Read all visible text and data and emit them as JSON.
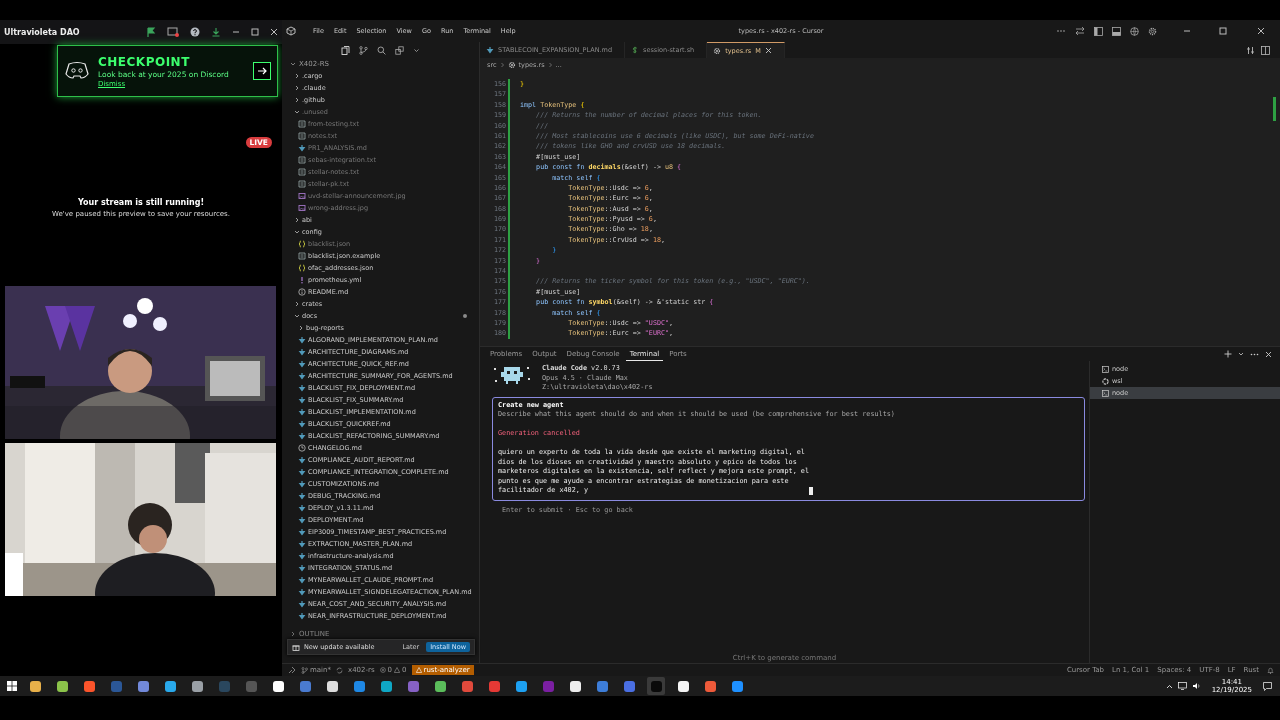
{
  "discord": {
    "title": "Ultravioleta DAO",
    "banner": {
      "heading": "CHECKPOINT",
      "text": "Look back at your 2025 on Discord",
      "link": "Dismiss"
    },
    "live_badge": "LIVE",
    "stream_notice": {
      "title": "Your stream is still running!",
      "text": "We've paused this preview to save your resources."
    }
  },
  "editor_window": {
    "menu": [
      "File",
      "Edit",
      "Selection",
      "View",
      "Go",
      "Run",
      "Terminal",
      "Help"
    ],
    "title": "types.rs - x402-rs - Cursor",
    "explorer": {
      "root": "X402-RS",
      "outline": "OUTLINE",
      "tree": [
        {
          "label": ".cargo",
          "kind": "folder",
          "expanded": false,
          "dimmed": false,
          "modified": false
        },
        {
          "label": ".claude",
          "kind": "folder",
          "expanded": false,
          "dimmed": false,
          "modified": false
        },
        {
          "label": ".github",
          "kind": "folder",
          "expanded": false,
          "dimmed": false,
          "modified": false
        },
        {
          "label": ".unused",
          "kind": "folder",
          "expanded": true,
          "dimmed": true,
          "modified": false,
          "children": [
            {
              "label": "from-testing.txt",
              "kind": "txt",
              "dimmed": true,
              "modified": false
            },
            {
              "label": "notes.txt",
              "kind": "txt",
              "dimmed": true,
              "modified": false
            },
            {
              "label": "PR1_ANALYSIS.md",
              "kind": "md",
              "dimmed": true,
              "modified": false
            },
            {
              "label": "sebas-integration.txt",
              "kind": "txt",
              "dimmed": true,
              "modified": false
            },
            {
              "label": "stellar-notes.txt",
              "kind": "txt",
              "dimmed": true,
              "modified": false
            },
            {
              "label": "stellar-pk.txt",
              "kind": "txt",
              "dimmed": true,
              "modified": false
            },
            {
              "label": "uvd-stellar-announcement.jpg",
              "kind": "jpg",
              "dimmed": true,
              "modified": false
            },
            {
              "label": "wrong-address.jpg",
              "kind": "jpg",
              "dimmed": true,
              "modified": false
            }
          ]
        },
        {
          "label": "abi",
          "kind": "folder",
          "expanded": false,
          "dimmed": false,
          "modified": false
        },
        {
          "label": "config",
          "kind": "folder",
          "expanded": true,
          "dimmed": false,
          "modified": false,
          "children": [
            {
              "label": "blacklist.json",
              "kind": "json",
              "dimmed": true,
              "modified": false
            },
            {
              "label": "blacklist.json.example",
              "kind": "txt",
              "dimmed": false,
              "modified": false
            },
            {
              "label": "ofac_addresses.json",
              "kind": "json",
              "dimmed": false,
              "modified": false
            },
            {
              "label": "prometheus.yml",
              "kind": "yml",
              "dimmed": false,
              "modified": false
            },
            {
              "label": "README.md",
              "kind": "info",
              "dimmed": false,
              "modified": false
            }
          ]
        },
        {
          "label": "crates",
          "kind": "folder",
          "expanded": false,
          "dimmed": false,
          "modified": false
        },
        {
          "label": "docs",
          "kind": "folder",
          "expanded": true,
          "dimmed": false,
          "modified": true,
          "children": [
            {
              "label": "bug-reports",
              "kind": "folder",
              "expanded": false,
              "dimmed": false,
              "modified": false
            },
            {
              "label": "ALGORAND_IMPLEMENTATION_PLAN.md",
              "kind": "md",
              "dimmed": false,
              "modified": false
            },
            {
              "label": "ARCHITECTURE_DIAGRAMS.md",
              "kind": "md",
              "dimmed": false,
              "modified": false
            },
            {
              "label": "ARCHITECTURE_QUICK_REF.md",
              "kind": "md",
              "dimmed": false,
              "modified": false
            },
            {
              "label": "ARCHITECTURE_SUMMARY_FOR_AGENTS.md",
              "kind": "md",
              "dimmed": false,
              "modified": false
            },
            {
              "label": "BLACKLIST_FIX_DEPLOYMENT.md",
              "kind": "md",
              "dimmed": false,
              "modified": false
            },
            {
              "label": "BLACKLIST_FIX_SUMMARY.md",
              "kind": "md",
              "dimmed": false,
              "modified": false
            },
            {
              "label": "BLACKLIST_IMPLEMENTATION.md",
              "kind": "md",
              "dimmed": false,
              "modified": false
            },
            {
              "label": "BLACKLIST_QUICKREF.md",
              "kind": "md",
              "dimmed": false,
              "modified": false
            },
            {
              "label": "BLACKLIST_REFACTORING_SUMMARY.md",
              "kind": "md",
              "dimmed": false,
              "modified": false
            },
            {
              "label": "CHANGELOG.md",
              "kind": "changelog",
              "dimmed": false,
              "modified": false
            },
            {
              "label": "COMPLIANCE_AUDIT_REPORT.md",
              "kind": "md",
              "dimmed": false,
              "modified": false
            },
            {
              "label": "COMPLIANCE_INTEGRATION_COMPLETE.md",
              "kind": "md",
              "dimmed": false,
              "modified": false
            },
            {
              "label": "CUSTOMIZATIONS.md",
              "kind": "md",
              "dimmed": false,
              "modified": false
            },
            {
              "label": "DEBUG_TRACKING.md",
              "kind": "md",
              "dimmed": false,
              "modified": false
            },
            {
              "label": "DEPLOY_v1.3.11.md",
              "kind": "md",
              "dimmed": false,
              "modified": false
            },
            {
              "label": "DEPLOYMENT.md",
              "kind": "md",
              "dimmed": false,
              "modified": false
            },
            {
              "label": "EIP3009_TIMESTAMP_BEST_PRACTICES.md",
              "kind": "md",
              "dimmed": false,
              "modified": false
            },
            {
              "label": "EXTRACTION_MASTER_PLAN.md",
              "kind": "md",
              "dimmed": false,
              "modified": false
            },
            {
              "label": "infrastructure-analysis.md",
              "kind": "md",
              "dimmed": false,
              "modified": false
            },
            {
              "label": "INTEGRATION_STATUS.md",
              "kind": "md",
              "dimmed": false,
              "modified": false
            },
            {
              "label": "MYNEARWALLET_CLAUDE_PROMPT.md",
              "kind": "md",
              "dimmed": false,
              "modified": false
            },
            {
              "label": "MYNEARWALLET_SIGNDELEGATEACTION_PLAN.md",
              "kind": "md",
              "dimmed": false,
              "modified": false
            },
            {
              "label": "NEAR_COST_AND_SECURITY_ANALYSIS.md",
              "kind": "md",
              "dimmed": false,
              "modified": false
            },
            {
              "label": "NEAR_INFRASTRUCTURE_DEPLOYMENT.md",
              "kind": "md",
              "dimmed": false,
              "modified": false
            }
          ]
        }
      ]
    },
    "tabs": [
      {
        "label": "STABLECOIN_EXPANSION_PLAN.md",
        "kind": "md",
        "selected": false
      },
      {
        "label": "session-start.sh",
        "kind": "sh",
        "selected": false
      },
      {
        "label": "types.rs",
        "kind": "rs",
        "selected": true,
        "badge": "M"
      }
    ],
    "breadcrumb": [
      "src",
      "types.rs",
      "..."
    ],
    "code": [
      {
        "number": "156",
        "tokens": [
          {
            "kind": "p0",
            "text": "}"
          }
        ]
      },
      {
        "number": "157"
      },
      {
        "number": "158",
        "tokens": [
          {
            "kind": "k",
            "text": "impl "
          },
          {
            "kind": "t",
            "text": "TokenType "
          },
          {
            "kind": "p0",
            "text": "{"
          }
        ]
      },
      {
        "number": "159",
        "tokens": [
          {
            "kind": "c",
            "text": "    /// Returns the number of decimal places for this token."
          }
        ]
      },
      {
        "number": "160",
        "tokens": [
          {
            "kind": "c",
            "text": "    ///"
          }
        ]
      },
      {
        "number": "161",
        "tokens": [
          {
            "kind": "c",
            "text": "    /// Most stablecoins use 6 decimals (like USDC), but some DeFi-native"
          }
        ]
      },
      {
        "number": "162",
        "tokens": [
          {
            "kind": "c",
            "text": "    /// tokens like GHO and crvUSD use 18 decimals."
          }
        ]
      },
      {
        "number": "163",
        "tokens": [
          {
            "kind": "x",
            "text": "    #[must_use]"
          }
        ]
      },
      {
        "number": "164",
        "tokens": [
          {
            "kind": "k",
            "text": "    pub const fn "
          },
          {
            "kind": "f",
            "text": "decimals"
          },
          {
            "kind": "x",
            "text": "(&self) -> "
          },
          {
            "kind": "t",
            "text": "u8 "
          },
          {
            "kind": "p1",
            "text": "{"
          }
        ]
      },
      {
        "number": "165",
        "tokens": [
          {
            "kind": "k",
            "text": "        match self "
          },
          {
            "kind": "p2",
            "text": "{"
          }
        ]
      },
      {
        "number": "166",
        "tokens": [
          {
            "kind": "t",
            "text": "            TokenType"
          },
          {
            "kind": "x",
            "text": "::Usdc => "
          },
          {
            "kind": "n",
            "text": "6"
          },
          {
            "kind": "x",
            "text": ","
          }
        ]
      },
      {
        "number": "167",
        "tokens": [
          {
            "kind": "t",
            "text": "            TokenType"
          },
          {
            "kind": "x",
            "text": "::Eurc => "
          },
          {
            "kind": "n",
            "text": "6"
          },
          {
            "kind": "x",
            "text": ","
          }
        ]
      },
      {
        "number": "168",
        "tokens": [
          {
            "kind": "t",
            "text": "            TokenType"
          },
          {
            "kind": "x",
            "text": "::Ausd => "
          },
          {
            "kind": "n",
            "text": "6"
          },
          {
            "kind": "x",
            "text": ","
          }
        ]
      },
      {
        "number": "169",
        "tokens": [
          {
            "kind": "t",
            "text": "            TokenType"
          },
          {
            "kind": "x",
            "text": "::Pyusd => "
          },
          {
            "kind": "n",
            "text": "6"
          },
          {
            "kind": "x",
            "text": ","
          }
        ]
      },
      {
        "number": "170",
        "tokens": [
          {
            "kind": "t",
            "text": "            TokenType"
          },
          {
            "kind": "x",
            "text": "::Gho => "
          },
          {
            "kind": "n",
            "text": "18"
          },
          {
            "kind": "x",
            "text": ","
          }
        ]
      },
      {
        "number": "171",
        "tokens": [
          {
            "kind": "t",
            "text": "            TokenType"
          },
          {
            "kind": "x",
            "text": "::CrvUsd => "
          },
          {
            "kind": "n",
            "text": "18"
          },
          {
            "kind": "x",
            "text": ","
          }
        ]
      },
      {
        "number": "172",
        "tokens": [
          {
            "kind": "p2",
            "text": "        }"
          }
        ]
      },
      {
        "number": "173",
        "tokens": [
          {
            "kind": "p1",
            "text": "    }"
          }
        ]
      },
      {
        "number": "174"
      },
      {
        "number": "175",
        "tokens": [
          {
            "kind": "c",
            "text": "    /// Returns the ticker symbol for this token (e.g., \"USDC\", \"EURC\")."
          }
        ]
      },
      {
        "number": "176",
        "tokens": [
          {
            "kind": "x",
            "text": "    #[must_use]"
          }
        ]
      },
      {
        "number": "177",
        "tokens": [
          {
            "kind": "k",
            "text": "    pub const fn "
          },
          {
            "kind": "f",
            "text": "symbol"
          },
          {
            "kind": "x",
            "text": "(&self) -> &'static str "
          },
          {
            "kind": "p1",
            "text": "{"
          }
        ]
      },
      {
        "number": "178",
        "tokens": [
          {
            "kind": "k",
            "text": "        match self "
          },
          {
            "kind": "p2",
            "text": "{"
          }
        ]
      },
      {
        "number": "179",
        "tokens": [
          {
            "kind": "t",
            "text": "            TokenType"
          },
          {
            "kind": "x",
            "text": "::Usdc => "
          },
          {
            "kind": "s",
            "text": "\"USDC\""
          },
          {
            "kind": "x",
            "text": ","
          }
        ]
      },
      {
        "number": "180",
        "tokens": [
          {
            "kind": "t",
            "text": "            TokenType"
          },
          {
            "kind": "x",
            "text": "::Eurc => "
          },
          {
            "kind": "s",
            "text": "\"EURC\""
          },
          {
            "kind": "x",
            "text": ","
          }
        ]
      }
    ],
    "panel": {
      "tabs": [
        {
          "label": "Problems",
          "selected": false
        },
        {
          "label": "Output",
          "selected": false
        },
        {
          "label": "Debug Console",
          "selected": false
        },
        {
          "label": "Terminal",
          "selected": true
        },
        {
          "label": "Ports",
          "selected": false
        }
      ],
      "terminal": {
        "header": [
          "**Claude Code** v2.0.73",
          "Opus 4.5 · Claude Max",
          "Z:\\ultravioleta\\dao\\x402-rs"
        ],
        "dialog": {
          "title": "Create new agent",
          "description": "Describe what this agent should do and when it should be used (be comprehensive for best results)",
          "error": "Generation cancelled",
          "input": "quiero un experto de toda la vida desde que existe el marketing digital, el\ndios de los dioses en creatividad y maestro absoluto y epico de todos los\nmarketeros digitales en la existencia, self reflect y mejora este prompt, el\npunto es que me ayude a encontrar estrategias de monetizacion para este\nfacilitador de x402, y "
        },
        "hint": "Enter to submit · Esc to go back",
        "command_hint": "Ctrl+K to generate command"
      },
      "sessions": [
        {
          "label": "node",
          "kind": "console",
          "selected": false
        },
        {
          "label": "wsl",
          "kind": "wsl",
          "selected": false
        },
        {
          "label": "node",
          "kind": "console",
          "selected": true
        }
      ]
    },
    "notification": {
      "text": "New update available",
      "buttons": [
        "Later",
        "Install Now"
      ]
    },
    "status_bar": {
      "branch": "main*",
      "project": "x402-rs",
      "errors": "0",
      "warnings": "0",
      "extension": "rust-analyzer",
      "right": [
        "Cursor Tab",
        "Ln 1, Col 1",
        "Spaces: 4",
        "UTF-8",
        "LF",
        "Rust"
      ]
    }
  },
  "taskbar": {
    "apps": [
      {
        "color": "#e8b04a",
        "selected": false
      },
      {
        "color": "#8bc34a",
        "selected": false
      },
      {
        "color": "#fb542b",
        "selected": false
      },
      {
        "color": "#2b5797",
        "selected": false
      },
      {
        "color": "#7289da",
        "selected": false
      },
      {
        "color": "#29a9eb",
        "selected": false
      },
      {
        "color": "#9aa0a6",
        "selected": false
      },
      {
        "color": "#2a475e",
        "selected": false
      },
      {
        "color": "#555555",
        "selected": false
      },
      {
        "color": "#ffffff",
        "selected": false
      },
      {
        "color": "#4a7bd0",
        "selected": false
      },
      {
        "color": "#dddddd",
        "selected": false
      },
      {
        "color": "#1e88e5",
        "selected": false
      },
      {
        "color": "#0fa7c5",
        "selected": false
      },
      {
        "color": "#8661c5",
        "selected": false
      },
      {
        "color": "#5bbd5b",
        "selected": false
      },
      {
        "color": "#e04a3c",
        "selected": false
      },
      {
        "color": "#e53935",
        "selected": false
      },
      {
        "color": "#1da1f2",
        "selected": false
      },
      {
        "color": "#7b1fa2",
        "selected": false
      },
      {
        "color": "#eeeeee",
        "selected": false
      },
      {
        "color": "#3d7dd8",
        "selected": false
      },
      {
        "color": "#4a6fe3",
        "selected": false
      },
      {
        "color": "#0a0a0a",
        "selected": true
      },
      {
        "color": "#f5f5f5",
        "selected": false
      },
      {
        "color": "#ee5a3a",
        "selected": false
      },
      {
        "color": "#1e90ff",
        "selected": false
      }
    ],
    "time": "14:41",
    "date": "12/19/2025"
  }
}
